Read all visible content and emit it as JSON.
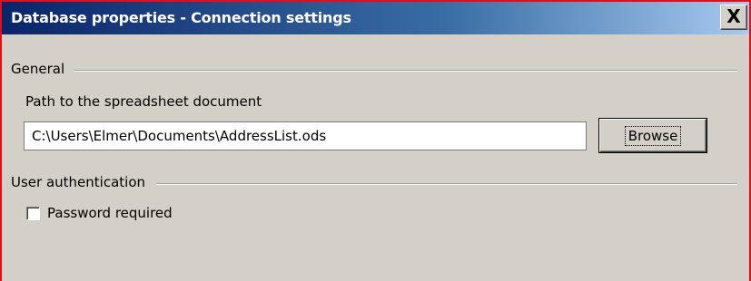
{
  "window": {
    "title": "Database properties - Connection settings",
    "close_glyph": "X"
  },
  "general": {
    "section_label": "General",
    "path_label": "Path to the spreadsheet document",
    "path_value": "C:\\Users\\Elmer\\Documents\\AddressList.ods",
    "browse_label": "Browse"
  },
  "auth": {
    "section_label": "User authentication",
    "password_required_label": "Password required",
    "password_required_checked": false
  },
  "colors": {
    "title_bar_start": "#0a246a",
    "title_bar_end": "#a6caf0",
    "dialog_background": "#d4d0c8",
    "window_border": "#e0101a"
  },
  "icons": {
    "close": "close-icon"
  }
}
